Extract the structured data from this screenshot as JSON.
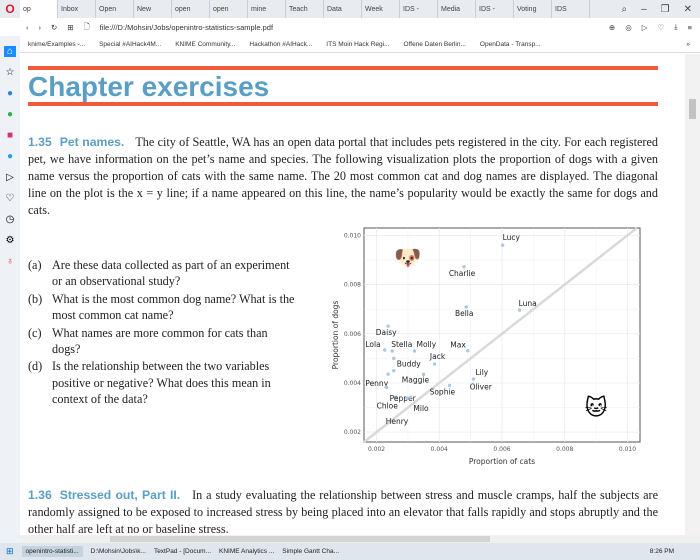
{
  "browser": {
    "tabs": [
      "op",
      "Inbox",
      "Open",
      "New",
      "open",
      "open",
      "mine",
      "Teach",
      "Data",
      "Week",
      "IDS -",
      "Media",
      "IDS -",
      "Voting",
      "IDS"
    ],
    "url": "file:///D:/Mohsin/Jobs/openintro-statistics-sample.pdf",
    "bookmarks": [
      "knime/Examples -...",
      "Special #AIHack4M...",
      "KNIME Community...",
      "Hackathon #AIHack...",
      "ITS Moin Hack Regi...",
      "Offene Daten Berlin...",
      "OpenData - Transp..."
    ]
  },
  "doc": {
    "heading": "Chapter exercises",
    "ex1": {
      "num": "1.35",
      "title": "Pet names.",
      "text": "The city of Seattle, WA has an open data portal that includes pets registered in the city. For each registered pet, we have information on the pet’s name and species. The following visualization plots the proportion of dogs with a given name versus the proportion of cats with the same name. The 20 most common cat and dog names are displayed. The diagonal line on the plot is the x = y line; if a name appeared on this line, the name’s popularity would be exactly the same for dogs and cats."
    },
    "questions": [
      {
        "label": "(a)",
        "text": "Are these data collected as part of an experiment or an observational study?"
      },
      {
        "label": "(b)",
        "text": "What is the most common dog name? What is the most common cat name?"
      },
      {
        "label": "(c)",
        "text": "What names are more common for cats than dogs?"
      },
      {
        "label": "(d)",
        "text": "Is the relationship between the two variables positive or negative? What does this mean in context of the data?"
      }
    ],
    "ex2": {
      "num": "1.36",
      "title": "Stressed out, Part II.",
      "text": "In a study evaluating the relationship between stress and muscle cramps, half the subjects are randomly assigned to be exposed to increased stress by being placed into an elevator that falls rapidly and stops abruptly and the other half are left at no or baseline stress."
    }
  },
  "chart_data": {
    "type": "scatter",
    "xlabel": "Proportion of cats",
    "ylabel": "Proportion of dogs",
    "xlim": [
      0.0016,
      0.0104
    ],
    "ylim": [
      0.0016,
      0.0103
    ],
    "xticks": [
      "0.002",
      "0.004",
      "0.006",
      "0.008",
      "0.010"
    ],
    "yticks": [
      "0.002",
      "0.004",
      "0.006",
      "0.008",
      "0.010"
    ],
    "grid": true,
    "reference_line": "x = y",
    "point_color": "#a9c8e3",
    "points": [
      {
        "name": "Lucy",
        "x": 0.00602,
        "y": 0.0096
      },
      {
        "name": "Charlie",
        "x": 0.00479,
        "y": 0.00872
      },
      {
        "name": "Bella",
        "x": 0.00486,
        "y": 0.00709
      },
      {
        "name": "Luna",
        "x": 0.00656,
        "y": 0.00696
      },
      {
        "name": "Daisy",
        "x": 0.00237,
        "y": 0.00631
      },
      {
        "name": "Lola",
        "x": 0.00226,
        "y": 0.00534
      },
      {
        "name": "Stella",
        "x": 0.0025,
        "y": 0.0053
      },
      {
        "name": "Molly",
        "x": 0.00321,
        "y": 0.0053
      },
      {
        "name": "Max",
        "x": 0.00491,
        "y": 0.00531
      },
      {
        "name": "Buddy",
        "x": 0.00255,
        "y": 0.005
      },
      {
        "name": "Jack",
        "x": 0.00385,
        "y": 0.00477
      },
      {
        "name": "Penny",
        "x": 0.00237,
        "y": 0.00436
      },
      {
        "name": "Maggie",
        "x": 0.00255,
        "y": 0.0045
      },
      {
        "name": "Sophie",
        "x": 0.0035,
        "y": 0.00435
      },
      {
        "name": "Lily",
        "x": 0.00509,
        "y": 0.00416
      },
      {
        "name": "Oliver",
        "x": 0.00433,
        "y": 0.0039
      },
      {
        "name": "Chloe",
        "x": 0.00232,
        "y": 0.00382
      },
      {
        "name": "Pepper",
        "x": 0.00261,
        "y": 0.00342
      },
      {
        "name": "Milo",
        "x": 0.00308,
        "y": 0.00342
      },
      {
        "name": "Henry",
        "x": 0.00297,
        "y": 0.00338
      }
    ]
  },
  "taskbar": {
    "items": [
      "openintro-statisti...",
      "D:\\Mohsin\\Jobs\\k...",
      "TextPad - [Docum...",
      "KNIME Analytics ...",
      "Simple Gantt Cha..."
    ],
    "time": "8:26 PM"
  }
}
